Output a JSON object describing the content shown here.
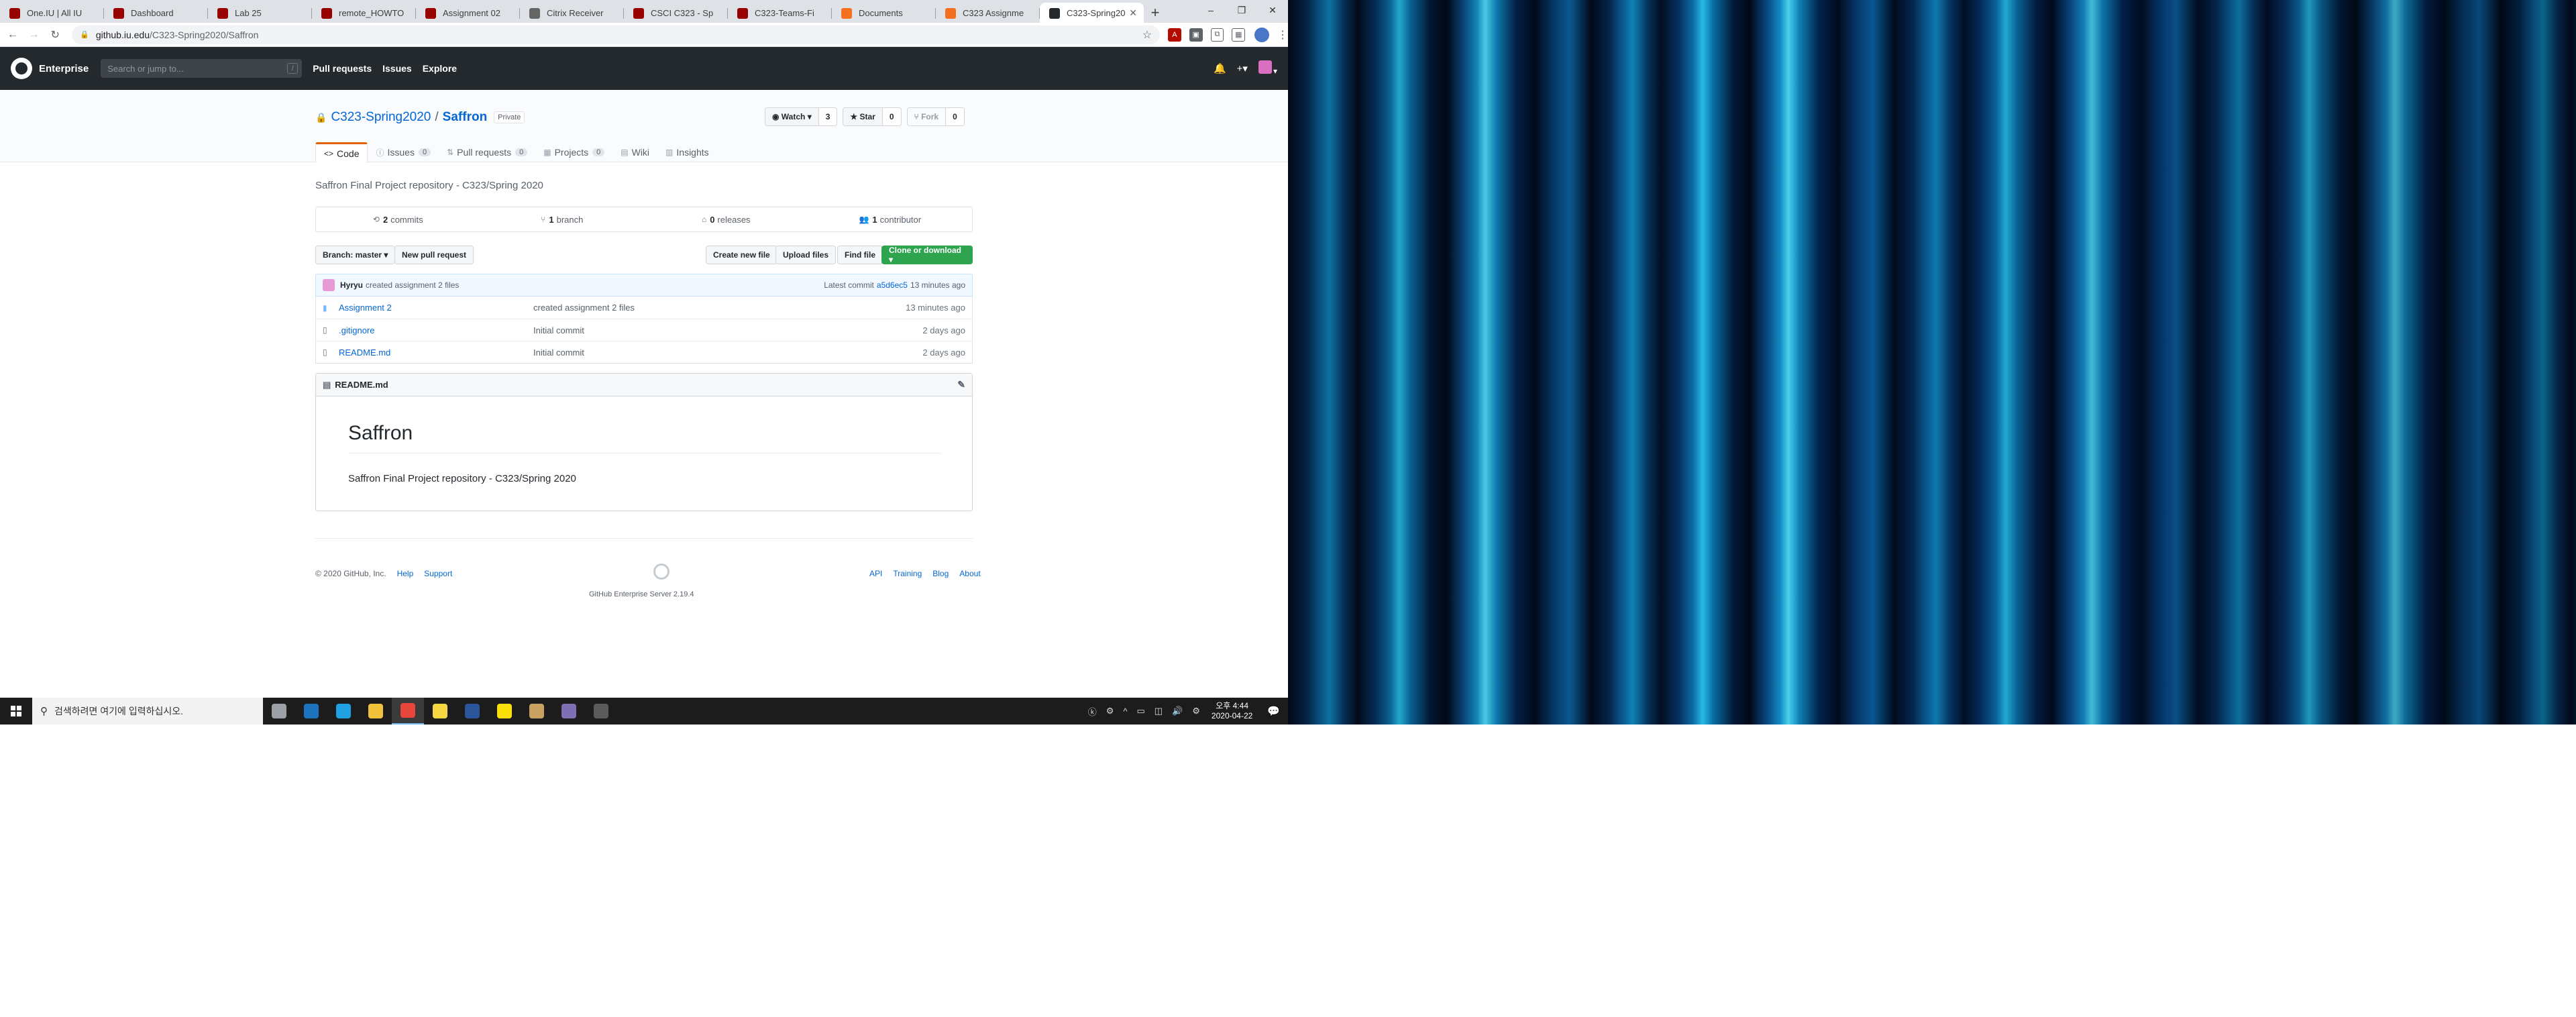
{
  "browser": {
    "tabs": [
      {
        "title": "One.IU | All IU",
        "favicon_color": "#990000"
      },
      {
        "title": "Dashboard",
        "favicon_color": "#990000"
      },
      {
        "title": "Lab 25",
        "favicon_color": "#990000"
      },
      {
        "title": "remote_HOWTO",
        "favicon_color": "#990000"
      },
      {
        "title": "Assignment 02",
        "favicon_color": "#990000"
      },
      {
        "title": "Citrix Receiver",
        "favicon_color": "#666666"
      },
      {
        "title": "CSCI C323 - Sp",
        "favicon_color": "#990000"
      },
      {
        "title": "C323-Teams-Fi",
        "favicon_color": "#990000"
      },
      {
        "title": "Documents",
        "favicon_color": "#f37021"
      },
      {
        "title": "C323 Assignme",
        "favicon_color": "#f37021"
      },
      {
        "title": "C323-Spring20",
        "favicon_color": "#24292e",
        "active": true
      }
    ],
    "new_tab_label": "+",
    "window_controls": {
      "minimize": "–",
      "maximize": "❐",
      "close": "✕"
    },
    "url_host": "github.iu.edu",
    "url_path": "/C323-Spring2020/Saffron",
    "star_icon": "☆"
  },
  "github": {
    "header": {
      "brand": "Enterprise",
      "search_placeholder": "Search or jump to...",
      "search_hint": "/",
      "nav": [
        "Pull requests",
        "Issues",
        "Explore"
      ],
      "bell": "🔔",
      "plus": "+▾",
      "avatar_caret": "▾"
    },
    "repo": {
      "owner": "C323-Spring2020",
      "separator": "/",
      "name": "Saffron",
      "visibility": "Private",
      "watch_label": "◉ Watch ▾",
      "watch_count": "3",
      "star_label": "★ Star",
      "star_count": "0",
      "fork_label": "⑂ Fork",
      "fork_count": "0",
      "tabs": [
        {
          "label": "Code",
          "icon": "<>",
          "count": ""
        },
        {
          "label": "Issues",
          "icon": "ⓘ",
          "count": "0"
        },
        {
          "label": "Pull requests",
          "icon": "⇅",
          "count": "0"
        },
        {
          "label": "Projects",
          "icon": "▦",
          "count": "0"
        },
        {
          "label": "Wiki",
          "icon": "▤",
          "count": ""
        },
        {
          "label": "Insights",
          "icon": "▥",
          "count": ""
        }
      ],
      "description": "Saffron Final Project repository - C323/Spring 2020",
      "numbers": {
        "commits_num": "2",
        "commits_label": "commits",
        "branches_num": "1",
        "branches_label": "branch",
        "releases_num": "0",
        "releases_label": "releases",
        "contributors_num": "1",
        "contributors_label": "contributor"
      },
      "branch_button": "Branch: master ▾",
      "new_pr_button": "New pull request",
      "create_file_button": "Create new file",
      "upload_button": "Upload files",
      "find_button": "Find file",
      "clone_button": "Clone or download ▾",
      "latest_commit": {
        "author": "Hyryu",
        "message": "created assignment 2 files",
        "prefix": "Latest commit",
        "sha": "a5d6ec5",
        "age": "13 minutes ago"
      },
      "files": [
        {
          "name": "Assignment 2",
          "type": "dir",
          "message": "created assignment 2 files",
          "age": "13 minutes ago"
        },
        {
          "name": ".gitignore",
          "type": "file",
          "message": "Initial commit",
          "age": "2 days ago"
        },
        {
          "name": "README.md",
          "type": "file",
          "message": "Initial commit",
          "age": "2 days ago"
        }
      ],
      "readme": {
        "filename": "README.md",
        "edit_icon": "✎",
        "heading": "Saffron",
        "body": "Saffron Final Project repository - C323/Spring 2020"
      }
    },
    "footer": {
      "copyright": "© 2020 GitHub, Inc.",
      "help": "Help",
      "support": "Support",
      "version": "GitHub Enterprise Server 2.19.4",
      "links": [
        "API",
        "Training",
        "Blog",
        "About"
      ]
    }
  },
  "taskbar": {
    "search_placeholder": "검색하려면 여기에 입력하십시오.",
    "apps": [
      {
        "name": "task-view",
        "color": "#9aa0a6"
      },
      {
        "name": "edge",
        "color": "#1e73be"
      },
      {
        "name": "ie",
        "color": "#1ea1e0"
      },
      {
        "name": "file-explorer",
        "color": "#f0c23b"
      },
      {
        "name": "chrome",
        "color": "#e8453c",
        "active": true
      },
      {
        "name": "sticky-notes",
        "color": "#f6d743"
      },
      {
        "name": "word",
        "color": "#2b579a"
      },
      {
        "name": "kakaotalk",
        "color": "#f9e000"
      },
      {
        "name": "app-generic",
        "color": "#c8a060"
      },
      {
        "name": "citrix",
        "color": "#7e6fb4"
      },
      {
        "name": "calculator",
        "color": "#5a5a5a"
      }
    ],
    "tray_icons": [
      "ⓚ",
      "⚙",
      "^",
      "▭",
      "◫",
      "🔊",
      "⚙"
    ],
    "clock_time": "오후 4:44",
    "clock_date": "2020-04-22",
    "notification_icon": "💬"
  }
}
